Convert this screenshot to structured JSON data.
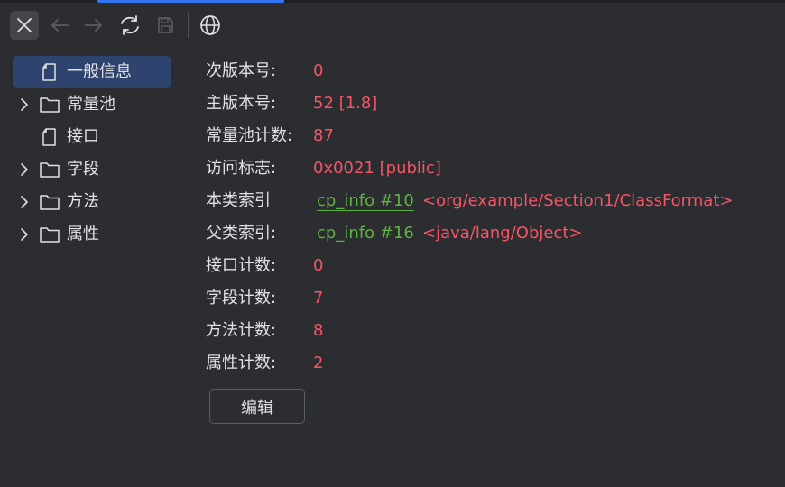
{
  "toolbar": {
    "buttons": [
      {
        "icon": "close-icon",
        "active": true
      },
      {
        "icon": "arrow-left-icon",
        "enabled": false
      },
      {
        "icon": "arrow-right-icon",
        "enabled": false
      },
      {
        "icon": "refresh-icon",
        "enabled": true
      },
      {
        "icon": "save-icon",
        "enabled": false
      },
      {
        "icon": "globe-icon",
        "enabled": true
      }
    ]
  },
  "tree": {
    "items": [
      {
        "label": "一般信息",
        "icon": "file-icon",
        "expandable": false,
        "selected": true
      },
      {
        "label": "常量池",
        "icon": "folder-icon",
        "expandable": true,
        "selected": false
      },
      {
        "label": "接口",
        "icon": "file-icon",
        "expandable": false,
        "selected": false
      },
      {
        "label": "字段",
        "icon": "folder-icon",
        "expandable": true,
        "selected": false
      },
      {
        "label": "方法",
        "icon": "folder-icon",
        "expandable": true,
        "selected": false
      },
      {
        "label": "属性",
        "icon": "folder-icon",
        "expandable": true,
        "selected": false
      }
    ]
  },
  "info": {
    "minor_version": {
      "label": "次版本号:",
      "value": "0"
    },
    "major_version": {
      "label": "主版本号:",
      "value": "52 [1.8]"
    },
    "constant_pool_count": {
      "label": "常量池计数:",
      "value": "87"
    },
    "access_flags": {
      "label": "访问标志:",
      "value": "0x0021 [public]"
    },
    "this_class": {
      "label": "本类索引",
      "link": "cp_info #10",
      "ref": "<org/example/Section1/ClassFormat>"
    },
    "super_class": {
      "label": "父类索引:",
      "link": "cp_info #16",
      "ref": "<java/lang/Object>"
    },
    "interfaces_count": {
      "label": "接口计数:",
      "value": "0"
    },
    "fields_count": {
      "label": "字段计数:",
      "value": "7"
    },
    "methods_count": {
      "label": "方法计数:",
      "value": "8"
    },
    "attributes_count": {
      "label": "属性计数:",
      "value": "2"
    }
  },
  "edit_button": {
    "label": "编辑"
  },
  "colors": {
    "background": "#2b2d30",
    "selection": "#2e436e",
    "value": "#f75464",
    "link": "#5fb340",
    "accent": "#3574f0"
  }
}
